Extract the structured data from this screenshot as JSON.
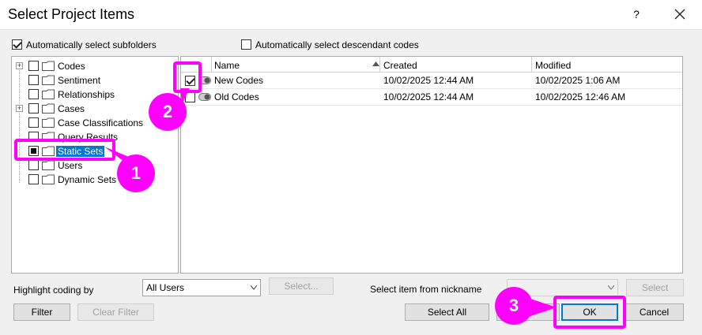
{
  "window": {
    "title": "Select Project Items",
    "help": "?"
  },
  "options": {
    "auto_subfolders": "Automatically select subfolders",
    "auto_descendant": "Automatically select descendant codes"
  },
  "tree": {
    "items": [
      {
        "label": "Codes"
      },
      {
        "label": "Sentiment"
      },
      {
        "label": "Relationships"
      },
      {
        "label": "Cases"
      },
      {
        "label": "Case Classifications"
      },
      {
        "label": "Query Results"
      },
      {
        "label": "Static Sets"
      },
      {
        "label": "Users"
      },
      {
        "label": "Dynamic Sets"
      }
    ]
  },
  "grid": {
    "columns": {
      "name": "Name",
      "created": "Created",
      "modified": "Modified"
    },
    "rows": [
      {
        "name": "New Codes",
        "created": "10/02/2025 12:44 AM",
        "modified": "10/02/2025 1:06 AM"
      },
      {
        "name": "Old Codes",
        "created": "10/02/2025 12:44 AM",
        "modified": "10/02/2025 12:46 AM"
      }
    ]
  },
  "footer": {
    "highlight_label": "Highlight coding by",
    "highlight_value": "All Users",
    "select_btn": "Select...",
    "nickname_label": "Select item from nickname",
    "nickname_value": "",
    "nickname_select_btn": "Select",
    "filter_btn": "Filter",
    "clear_filter_btn": "Clear Filter",
    "select_all_btn": "Select All",
    "ok_btn": "OK",
    "cancel_btn": "Cancel"
  },
  "annotations": {
    "badge1": "1",
    "badge2": "2",
    "badge3": "3"
  },
  "colors": {
    "highlight": "#ff00ff",
    "selection": "#0078d7"
  }
}
